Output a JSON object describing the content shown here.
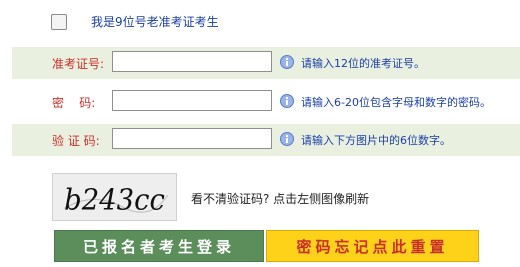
{
  "checkbox": {
    "label": "我是9位号老准考证考生",
    "checked": false
  },
  "rows": [
    {
      "label": "准考证号:",
      "hint": "请输入12位的准考证号。",
      "value": ""
    },
    {
      "label": "密    码:",
      "hint": "请输入6-20位包含字母和数字的密码。",
      "value": ""
    },
    {
      "label": "验 证 码:",
      "hint": "请输入下方图片中的6位数字。",
      "value": ""
    }
  ],
  "captcha": {
    "text": "b243cc",
    "hint": "看不清验证码? 点击左侧图像刷新"
  },
  "buttons": {
    "login": "已报名者考生登录",
    "reset": "密码忘记点此重置"
  },
  "colors": {
    "row_bg": "#eaf0df",
    "label": "#c9302c",
    "hint": "#1a3fa8",
    "login_bg": "#5c8e5c",
    "reset_bg": "#ffd21a"
  },
  "icons": {
    "info": "info-circle-icon"
  }
}
